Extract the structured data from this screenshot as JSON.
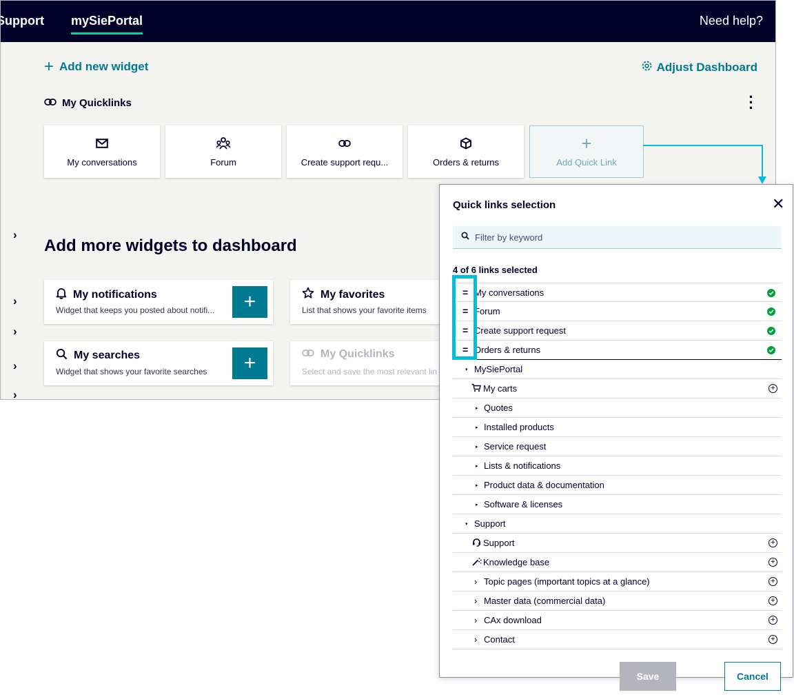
{
  "header": {
    "nav_support": "Support",
    "nav_portal": "mySiePortal",
    "help": "Need help?"
  },
  "dashboard": {
    "add_widget": "Add new widget",
    "adjust_dashboard": "Adjust Dashboard",
    "quicklinks_title": "My Quicklinks",
    "tiles": [
      {
        "label": "My conversations",
        "icon": "envelope-icon"
      },
      {
        "label": "Forum",
        "icon": "people-icon"
      },
      {
        "label": "Create support requ...",
        "icon": "link-icon"
      },
      {
        "label": "Orders & returns",
        "icon": "box-icon"
      },
      {
        "label": "Add Quick Link",
        "icon": "plus-icon"
      }
    ],
    "more_title": "Add more widgets to dashboard",
    "widgets": [
      {
        "title": "My notifications",
        "desc": "Widget that keeps you posted about notifi...",
        "icon": "bell-icon"
      },
      {
        "title": "My favorites",
        "desc": "List that shows your favorite items",
        "icon": "star-icon"
      },
      {
        "title": "My searches",
        "desc": "Widget that shows your favorite searches",
        "icon": "search-icon"
      },
      {
        "title": "My Quicklinks",
        "desc": "Select and save the most relevant lin",
        "icon": "link-icon"
      }
    ]
  },
  "modal": {
    "title": "Quick links selection",
    "filter_placeholder": "Filter by keyword",
    "count": "4 of 6 links selected",
    "selected": [
      {
        "label": "My conversations"
      },
      {
        "label": "Forum"
      },
      {
        "label": "Create support request"
      },
      {
        "label": "Orders & returns"
      }
    ],
    "group_mysieportal": "MySiePortal",
    "mysieportal_items": [
      {
        "label": "My carts"
      },
      {
        "label": "Quotes"
      },
      {
        "label": "Installed products"
      },
      {
        "label": "Service request"
      },
      {
        "label": "Lists & notifications"
      },
      {
        "label": "Product data & documentation"
      },
      {
        "label": "Software & licenses"
      }
    ],
    "group_support": "Support",
    "support_items": [
      {
        "label": "Support"
      },
      {
        "label": "Knowledge base"
      },
      {
        "label": "Topic pages (important topics at a glance)"
      },
      {
        "label": "Master data (commercial data)"
      },
      {
        "label": "CAx download"
      },
      {
        "label": "Contact"
      }
    ],
    "save": "Save",
    "cancel": "Cancel"
  },
  "colors": {
    "navy": "#000028",
    "petrol": "#007993",
    "accent": "#00bedc",
    "success": "#00a03a",
    "disabled": "#b4b4be"
  }
}
